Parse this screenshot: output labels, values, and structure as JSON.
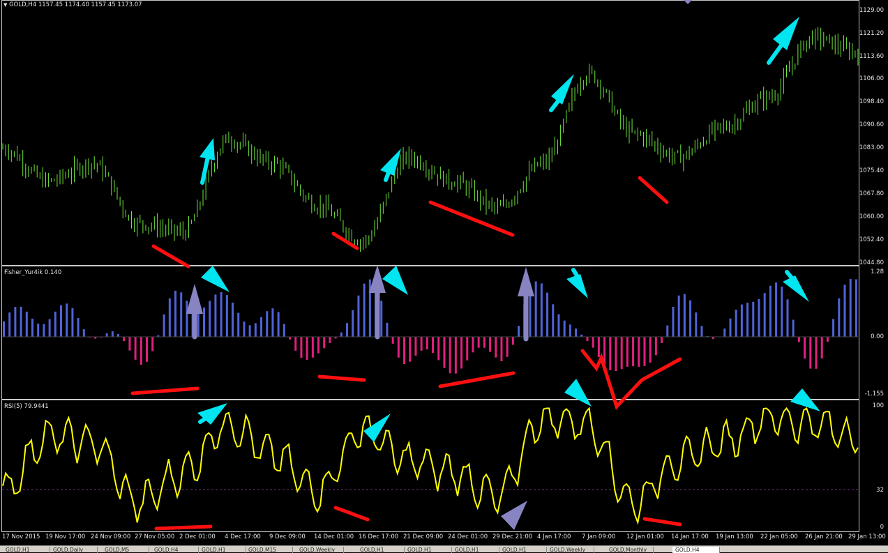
{
  "main_pane": {
    "title": "GOLD,H4  1157.45 1174.40 1157.45 1173.07",
    "price_scale": [
      "1129.00",
      "1121.20",
      "1113.60",
      "1106.00",
      "1098.40",
      "1090.60",
      "1083.00",
      "1075.40",
      "1067.80",
      "1060.00",
      "1052.40",
      "1044.80"
    ]
  },
  "fisher_pane": {
    "title": "Fisher_Yur4ik 0.140",
    "scale": [
      "1.28",
      "0.00",
      "-1.155"
    ]
  },
  "rsi_pane": {
    "title": "RSI(5) 79.9441",
    "scale": [
      "100",
      "32",
      "0"
    ],
    "level": 32
  },
  "time_axis": [
    "17 Nov 2015",
    "19 Nov 17:00",
    "24 Nov 09:00",
    "27 Nov 05:00",
    "2 Dec 01:00",
    "4 Dec 17:00",
    "9 Dec 09:00",
    "14 Dec 01:00",
    "16 Dec 17:00",
    "21 Dec 09:00",
    "24 Dec 01:00",
    "29 Dec 21:00",
    "4 Jan 17:00",
    "7 Jan 09:00",
    "12 Jan 01:00",
    "14 Jan 17:00",
    "19 Jan 13:00",
    "22 Jan 05:00",
    "26 Jan 21:00",
    "29 Jan 13:00"
  ],
  "tabs": [
    "GOLD,H1",
    "GOLD,Daily",
    "GOLD,M5",
    "GOLD,H4",
    "GOLD,H1",
    "GOLD,M15",
    "GOLD,Weekly",
    "GOLD,H1",
    "GOLD,H1",
    "GOLD,H1",
    "GOLD,H1",
    "GOLD,Weekly",
    "GOLD,Monthly",
    "GOLD,H4"
  ],
  "active_tab": 13,
  "colors": {
    "candles": "#6fe83a",
    "fisher_pos": "#4f63d8",
    "fisher_neg": "#e0207e",
    "rsi_line": "#ffff00",
    "rsi_level": "#7a2a8a",
    "divergence_line": "#ff1010",
    "signal_arrow": "#00e5ef",
    "grey_arrow": "#8884c2"
  },
  "chart_data": {
    "type": "line",
    "title": "GOLD,H4",
    "x": [
      "17 Nov 2015",
      "19 Nov 17:00",
      "24 Nov 09:00",
      "27 Nov 05:00",
      "2 Dec 01:00",
      "4 Dec 17:00",
      "9 Dec 09:00",
      "14 Dec 01:00",
      "16 Dec 17:00",
      "21 Dec 09:00",
      "24 Dec 01:00",
      "29 Dec 21:00",
      "4 Jan 17:00",
      "7 Jan 09:00",
      "12 Jan 01:00",
      "14 Jan 17:00",
      "19 Jan 13:00",
      "22 Jan 05:00",
      "26 Jan 21:00",
      "29 Jan 13:00"
    ],
    "series": [
      {
        "values": [
          1083,
          1072,
          1078,
          1058,
          1055,
          1086,
          1078,
          1064,
          1052,
          1080,
          1072,
          1063,
          1078,
          1108,
          1088,
          1080,
          1090,
          1100,
          1120,
          1115
        ]
      },
      {
        "values": [
          0.3,
          0.5,
          0.2,
          -0.5,
          0.8,
          0.6,
          0.3,
          -0.6,
          1.0,
          -0.5,
          -0.7,
          -0.4,
          1.0,
          -0.3,
          -1.0,
          0.6,
          0.1,
          1.1,
          -0.6,
          1.28
        ]
      },
      {
        "values": [
          30,
          75,
          70,
          20,
          45,
          85,
          60,
          30,
          80,
          55,
          45,
          25,
          90,
          85,
          20,
          55,
          70,
          90,
          85,
          75
        ]
      }
    ],
    "ylim": [
      1044.8,
      1129.0
    ]
  }
}
